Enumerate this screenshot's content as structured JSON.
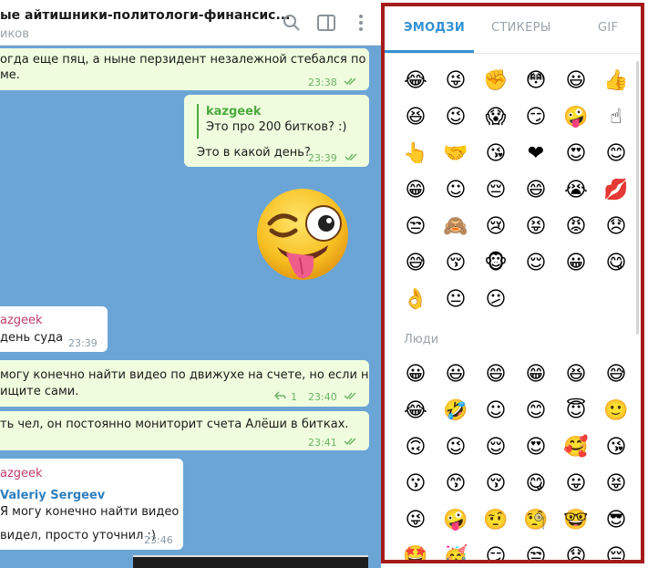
{
  "header": {
    "title": "ые айтишники-политологи-финансис...",
    "subtitle": "иков"
  },
  "messages": {
    "m1": {
      "line1": "огда еще пяц, а ныне перзидент  незалежной стебался по",
      "line2": "ме.",
      "time": "23:38"
    },
    "m2": {
      "reply_name": "kazgeek",
      "reply_text": "Это про 200 битков? :)",
      "text": "Это в какой день?",
      "time": "23:39"
    },
    "m3": {
      "author": "azgeek",
      "text": "день суда",
      "time": "23:39"
    },
    "m4": {
      "line1": "могу конечно найти видео по движухе на счете, но если нуно,",
      "line2": "ищите сами.",
      "replies": "1",
      "time": "23:40"
    },
    "m5": {
      "text": "ть чел, он постоянно мониторит счета Алёши в битках.",
      "time": "23:41"
    },
    "m6": {
      "author": "azgeek",
      "fwd_name": "Valeriy Sergeev",
      "fwd_text": "Я могу конечно найти видео ...",
      "text": "видел, просто уточнил :)",
      "time": "23:46"
    }
  },
  "emoji_panel": {
    "tabs": [
      {
        "label": "ЭМОДЗИ",
        "active": true
      },
      {
        "label": "СТИКЕРЫ",
        "active": false
      },
      {
        "label": "GIF",
        "active": false
      }
    ],
    "section_people": "Люди",
    "recent": [
      "😂",
      "😜",
      "✊",
      "😳",
      "😃",
      "👍",
      "😆",
      "😉",
      "😱",
      "😏",
      "🤪",
      "☝",
      "👆",
      "🤝",
      "😘",
      "❤",
      "😍",
      "😊",
      "😁",
      "☺",
      "😔",
      "😄",
      "😭",
      "💋",
      "😒",
      "🙈",
      "😢",
      "😝",
      "😡",
      "😞",
      "😅",
      "😚",
      "🐵",
      "😌",
      "😀",
      "😋",
      "👌",
      "😐",
      "😕"
    ],
    "people": [
      "😀",
      "😃",
      "😄",
      "😁",
      "😆",
      "😅",
      "😂",
      "🤣",
      "☺",
      "😊",
      "😇",
      "🙂",
      "🙃",
      "😉",
      "😌",
      "😍",
      "🥰",
      "😘",
      "😗",
      "😙",
      "😚",
      "😋",
      "😛",
      "😝",
      "😜",
      "🤪",
      "🤨",
      "🧐",
      "🤓",
      "😎",
      "🤩",
      "🥳",
      "😏",
      "😒",
      "😞",
      "😔"
    ]
  },
  "colors": {
    "accent": "#3390d6",
    "highlight_border": "#a61b1b",
    "chat_bg": "#6ba5d6",
    "out_bubble": "#effdde"
  }
}
